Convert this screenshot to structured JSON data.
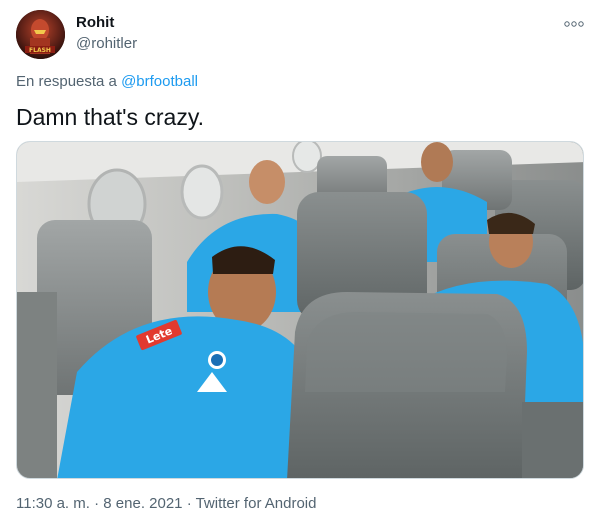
{
  "author": {
    "name": "Rohit",
    "handle": "@rohitler",
    "avatar": "avatar-image"
  },
  "reply": {
    "prefix": "En respuesta a ",
    "mention": "@brfootball"
  },
  "tweet": {
    "text": "Damn that's crazy.",
    "media": "photo-of-players-sleeping-on-plane"
  },
  "meta": {
    "time": "11:30 a. m.",
    "separator1": " · ",
    "date": "8 ene. 2021",
    "separator2": " · ",
    "source": "Twitter for Android"
  },
  "icons": {
    "more": "more-options-icon"
  },
  "colors": {
    "link": "#1d9bf0",
    "secondary_text": "#536471",
    "primary_text": "#0f1419",
    "jersey": "#2ba7e6"
  }
}
